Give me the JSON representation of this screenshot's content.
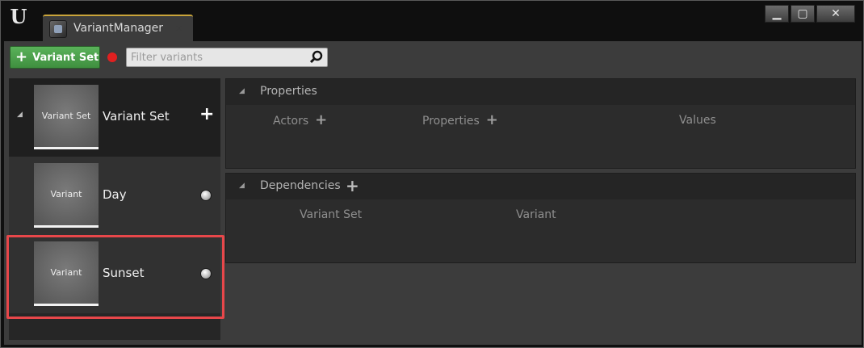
{
  "window": {
    "tab_title": "VariantManager",
    "tab_close": "✕",
    "controls": {
      "minimize": "▁",
      "maximize": "▢",
      "close": "✕"
    }
  },
  "toolbar": {
    "add_variant_set_label": "Variant Set",
    "filter_placeholder": "Filter variants"
  },
  "tree": {
    "variant_set": {
      "thumbnail_label": "Variant Set",
      "label": "Variant Set"
    },
    "variants": [
      {
        "thumbnail_label": "Variant",
        "label": "Day"
      },
      {
        "thumbnail_label": "Variant",
        "label": "Sunset"
      }
    ]
  },
  "properties": {
    "title": "Properties",
    "columns": {
      "actors": "Actors",
      "properties": "Properties",
      "values": "Values"
    }
  },
  "dependencies": {
    "title": "Dependencies",
    "columns": {
      "variant_set": "Variant Set",
      "variant": "Variant"
    }
  },
  "icons": {
    "app_logo": "unreal-logo-icon",
    "plus": "plus-icon",
    "search": "search-icon",
    "record": "record-dot-icon",
    "expand": "collapse-triangle-icon",
    "radio": "radio-button-icon"
  },
  "colors": {
    "accent_green": "#4aa24a",
    "record_red": "#e02020",
    "tab_accent": "#c9a43a",
    "highlight": "#e8474a"
  }
}
